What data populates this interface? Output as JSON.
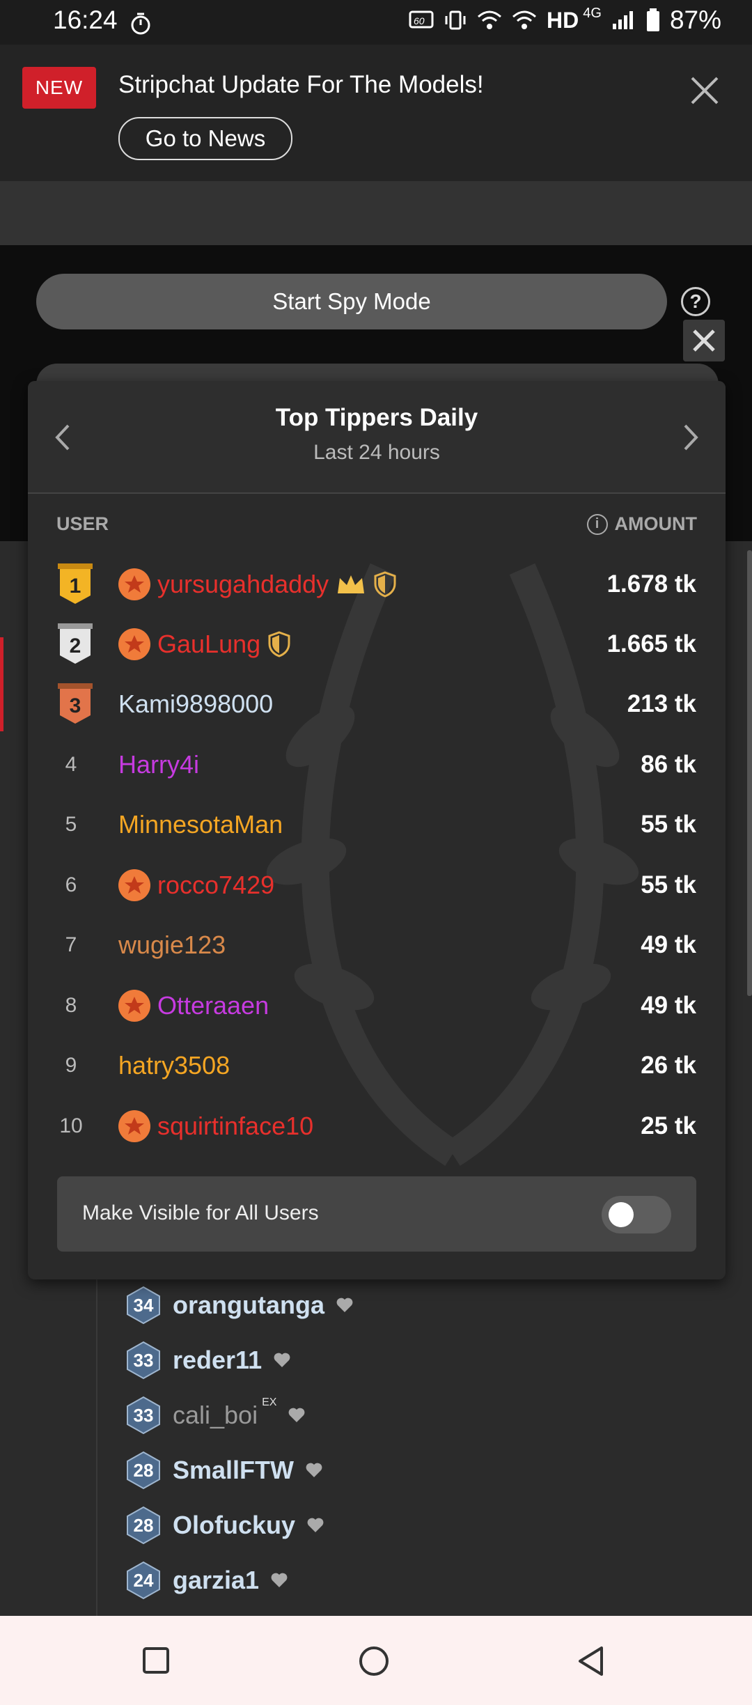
{
  "status_bar": {
    "time": "16:24",
    "network": "HD",
    "network_type": "4G",
    "battery": "87%"
  },
  "news_banner": {
    "badge": "NEW",
    "title": "Stripchat Update For The Models!",
    "button": "Go to News"
  },
  "spy_mode": {
    "button": "Start Spy Mode"
  },
  "top_tippers": {
    "title": "Top Tippers Daily",
    "subtitle": "Last 24 hours",
    "col_user": "USER",
    "col_amount": "AMOUNT",
    "rows": [
      {
        "rank": "1",
        "name": "yursugahdaddy",
        "amount": "1.678 tk",
        "color": "#e8302c"
      },
      {
        "rank": "2",
        "name": "GauLung",
        "amount": "1.665 tk",
        "color": "#e8302c"
      },
      {
        "rank": "3",
        "name": "Kami9898000",
        "amount": "213 tk",
        "color": "#cfe0f0"
      },
      {
        "rank": "4",
        "name": "Harry4i",
        "amount": "86 tk",
        "color": "#c63be0"
      },
      {
        "rank": "5",
        "name": "MinnesotaMan",
        "amount": "55 tk",
        "color": "#f5a623"
      },
      {
        "rank": "6",
        "name": "rocco7429",
        "amount": "55 tk",
        "color": "#e8302c"
      },
      {
        "rank": "7",
        "name": "wugie123",
        "amount": "49 tk",
        "color": "#d9894a"
      },
      {
        "rank": "8",
        "name": "Otteraaen",
        "amount": "49 tk",
        "color": "#c63be0"
      },
      {
        "rank": "9",
        "name": "hatry3508",
        "amount": "26 tk",
        "color": "#f5a623"
      },
      {
        "rank": "10",
        "name": "squirtinface10",
        "amount": "25 tk",
        "color": "#e8302c"
      }
    ],
    "visibility_label": "Make Visible for All Users"
  },
  "user_list": [
    {
      "level": "34",
      "name": "orangutanga"
    },
    {
      "level": "33",
      "name": "reder11"
    },
    {
      "level": "33",
      "name": "cali_boi",
      "tag": "EX"
    },
    {
      "level": "28",
      "name": "SmallFTW"
    },
    {
      "level": "28",
      "name": "Olofuckuy"
    },
    {
      "level": "24",
      "name": "garzia1"
    }
  ]
}
